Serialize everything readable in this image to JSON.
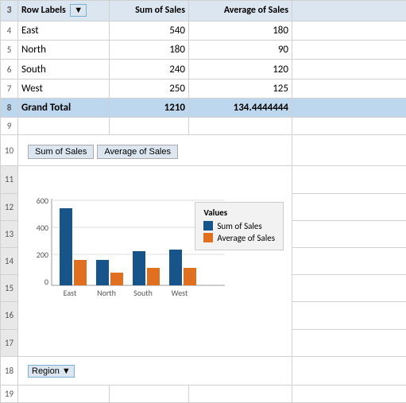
{
  "rows": {
    "header": {
      "row_num": "3",
      "col_a": "",
      "col_b_label": "Row Labels",
      "col_c_label": "Sum of Sales",
      "col_d_label": "Average of Sales",
      "col_e_label": ""
    },
    "data": [
      {
        "row_num": "4",
        "region": "East",
        "sum_sales": "540",
        "avg_sales": "180"
      },
      {
        "row_num": "5",
        "region": "North",
        "sum_sales": "180",
        "avg_sales": "90"
      },
      {
        "row_num": "6",
        "region": "South",
        "sum_sales": "240",
        "avg_sales": "120"
      },
      {
        "row_num": "7",
        "region": "West",
        "sum_sales": "250",
        "avg_sales": "125"
      }
    ],
    "grand_total": {
      "row_num": "8",
      "label": "Grand Total",
      "sum_sales": "1210",
      "avg_sales": "134.4444444"
    },
    "empty_rows": [
      "9",
      "10",
      "11",
      "12",
      "13",
      "14",
      "15",
      "16",
      "17",
      "18",
      "19"
    ]
  },
  "chart": {
    "buttons": [
      "Sum of Sales",
      "Average of Sales"
    ],
    "y_labels": [
      "600",
      "400",
      "200",
      "0"
    ],
    "x_labels": [
      "East",
      "North",
      "South",
      "West"
    ],
    "legend": {
      "title": "Values",
      "items": [
        {
          "label": "Sum of Sales",
          "color": "#17548a"
        },
        {
          "label": "Average of Sales",
          "color": "#e07020"
        }
      ]
    },
    "bars": {
      "east": {
        "sum": 540,
        "avg": 180
      },
      "north": {
        "sum": 180,
        "avg": 90
      },
      "south": {
        "sum": 240,
        "avg": 120
      },
      "west": {
        "sum": 250,
        "avg": 125
      }
    }
  },
  "filter": {
    "label": "Region",
    "dropdown_arrow": "▼"
  }
}
